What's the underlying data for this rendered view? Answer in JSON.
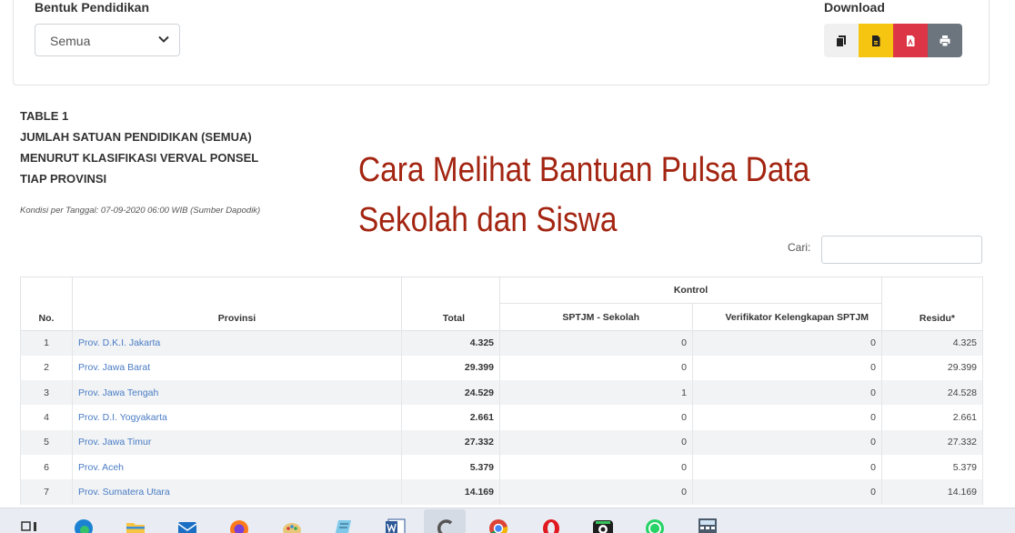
{
  "filter": {
    "label": "Bentuk Pendidikan",
    "selected": "Semua"
  },
  "download": {
    "label": "Download",
    "buttons": [
      "copy",
      "csv",
      "pdf",
      "print"
    ],
    "colors": {
      "copy": "#f0f0f0",
      "csv": "#f6c511",
      "pdf": "#dc3545",
      "print": "#6c757d"
    }
  },
  "caption": {
    "line1": "TABLE 1",
    "line2": "JUMLAH SATUAN PENDIDIKAN (SEMUA)",
    "line3": "MENURUT KLASIFIKASI VERVAL PONSEL",
    "line4": "TIAP PROVINSI",
    "condition": "Kondisi per Tanggal: 07-09-2020 06:00 WIB (Sumber Dapodik)"
  },
  "overlay": {
    "line1": "Cara Melihat Bantuan Pulsa Data",
    "line2": "Sekolah dan Siswa",
    "color": "#a32511"
  },
  "search": {
    "label": "Cari:",
    "value": ""
  },
  "table": {
    "headers": {
      "no": "No.",
      "provinsi": "Provinsi",
      "total": "Total",
      "kontrol": "Kontrol",
      "sptjm": "SPTJM - Sekolah",
      "verifikator": "Verifikator Kelengkapan SPTJM",
      "residu": "Residu*"
    },
    "rows": [
      {
        "no": "1",
        "provinsi": "Prov. D.K.I. Jakarta",
        "total": "4.325",
        "sptjm": "0",
        "verifikator": "0",
        "residu": "4.325"
      },
      {
        "no": "2",
        "provinsi": "Prov. Jawa Barat",
        "total": "29.399",
        "sptjm": "0",
        "verifikator": "0",
        "residu": "29.399"
      },
      {
        "no": "3",
        "provinsi": "Prov. Jawa Tengah",
        "total": "24.529",
        "sptjm": "1",
        "verifikator": "0",
        "residu": "24.528"
      },
      {
        "no": "4",
        "provinsi": "Prov. D.I. Yogyakarta",
        "total": "2.661",
        "sptjm": "0",
        "verifikator": "0",
        "residu": "2.661"
      },
      {
        "no": "5",
        "provinsi": "Prov. Jawa Timur",
        "total": "27.332",
        "sptjm": "0",
        "verifikator": "0",
        "residu": "27.332"
      },
      {
        "no": "6",
        "provinsi": "Prov. Aceh",
        "total": "5.379",
        "sptjm": "0",
        "verifikator": "0",
        "residu": "5.379"
      },
      {
        "no": "7",
        "provinsi": "Prov. Sumatera Utara",
        "total": "14.169",
        "sptjm": "0",
        "verifikator": "0",
        "residu": "14.169"
      }
    ]
  },
  "taskbar": {
    "icons": [
      "task-view-icon",
      "edge-icon",
      "file-explorer-icon",
      "mail-icon",
      "firefox-icon",
      "paint-icon",
      "notepad-icon",
      "word-icon",
      "app-c-icon",
      "chrome-icon",
      "opera-icon",
      "camera-app-icon",
      "whatsapp-icon",
      "calculator-icon"
    ]
  }
}
